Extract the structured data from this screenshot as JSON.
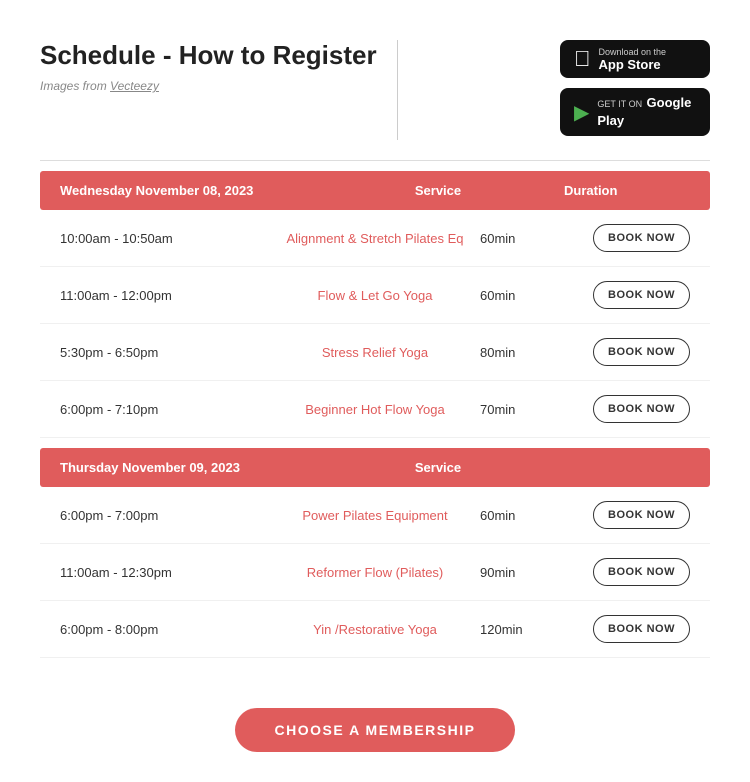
{
  "header": {
    "title": "Schedule - How to Register",
    "attribution_text": "Images from",
    "attribution_link": "Vecteezy",
    "app_store": {
      "top_line": "Download on the",
      "bottom_line": "App Store"
    },
    "google_play": {
      "top_line": "GET IT ON",
      "bottom_line": "Google Play"
    }
  },
  "schedule": {
    "days": [
      {
        "date": "Wednesday November 08, 2023",
        "service_label": "Service",
        "duration_label": "Duration",
        "classes": [
          {
            "time": "10:00am - 10:50am",
            "service": "Alignment & Stretch Pilates Eq",
            "duration": "60min",
            "book_label": "BOOK NOW"
          },
          {
            "time": "11:00am - 12:00pm",
            "service": "Flow & Let Go Yoga",
            "duration": "60min",
            "book_label": "BOOK NOW"
          },
          {
            "time": "5:30pm - 6:50pm",
            "service": "Stress Relief Yoga",
            "duration": "80min",
            "book_label": "BOOK NOW"
          },
          {
            "time": "6:00pm - 7:10pm",
            "service": "Beginner Hot Flow Yoga",
            "duration": "70min",
            "book_label": "BOOK NOW"
          }
        ]
      },
      {
        "date": "Thursday November 09, 2023",
        "service_label": "Service",
        "duration_label": "",
        "classes": [
          {
            "time": "6:00pm - 7:00pm",
            "service": "Power Pilates Equipment",
            "duration": "60min",
            "book_label": "BOOK NOW"
          },
          {
            "time": "11:00am - 12:30pm",
            "service": "Reformer Flow (Pilates)",
            "duration": "90min",
            "book_label": "BOOK NOW"
          },
          {
            "time": "6:00pm - 8:00pm",
            "service": "Yin /Restorative Yoga",
            "duration": "120min",
            "book_label": "BOOK NOW"
          }
        ]
      }
    ]
  },
  "membership": {
    "button_label": "CHOOSE A MEMBERSHIP"
  }
}
